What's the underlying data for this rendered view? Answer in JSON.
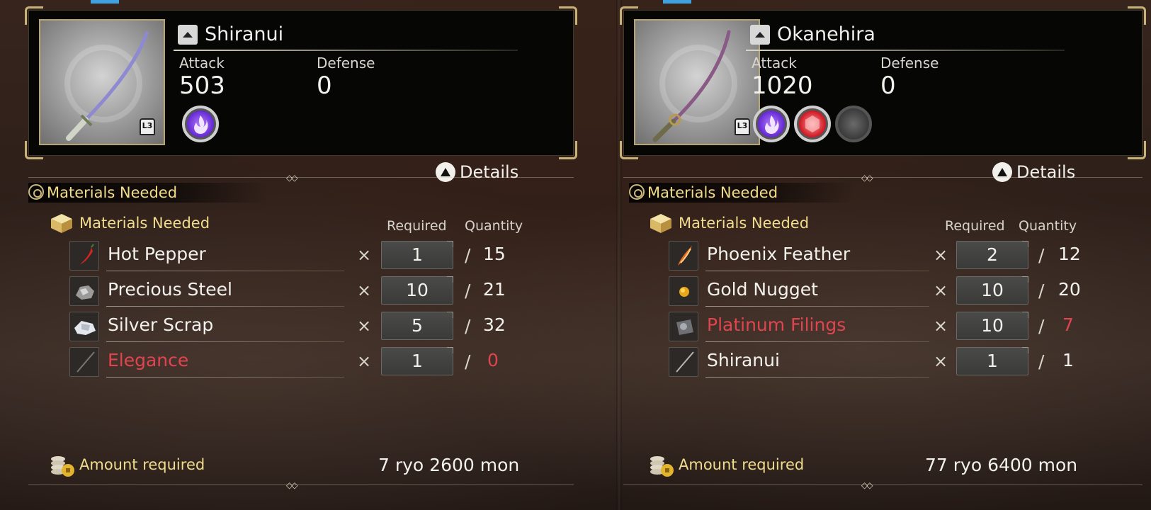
{
  "left": {
    "weapon": {
      "name": "Shiranui",
      "attack_label": "Attack",
      "attack_value": "503",
      "defense_label": "Defense",
      "defense_value": "0",
      "l3_label": "L3",
      "details_label": "Details"
    },
    "section_title": "Materials Needed",
    "materials_subhead": "Materials Needed",
    "col_required": "Required",
    "col_quantity": "Quantity",
    "materials": [
      {
        "name": "Hot Pepper",
        "times": "×",
        "required": "1",
        "slash": "/",
        "quantity": "15",
        "lacking": false,
        "icon": "hot-pepper-icon"
      },
      {
        "name": "Precious Steel",
        "times": "×",
        "required": "10",
        "slash": "/",
        "quantity": "21",
        "lacking": false,
        "icon": "precious-steel-icon"
      },
      {
        "name": "Silver Scrap",
        "times": "×",
        "required": "5",
        "slash": "/",
        "quantity": "32",
        "lacking": false,
        "icon": "silver-scrap-icon"
      },
      {
        "name": "Elegance",
        "times": "×",
        "required": "1",
        "slash": "/",
        "quantity": "0",
        "lacking": true,
        "icon": "sword-icon"
      }
    ],
    "amount_label": "Amount required",
    "amount_value": "7 ryo 2600 mon"
  },
  "right": {
    "weapon": {
      "name": "Okanehira",
      "attack_label": "Attack",
      "attack_value": "1020",
      "defense_label": "Defense",
      "defense_value": "0",
      "l3_label": "L3",
      "details_label": "Details"
    },
    "section_title": "Materials Needed",
    "materials_subhead": "Materials Needed",
    "col_required": "Required",
    "col_quantity": "Quantity",
    "materials": [
      {
        "name": "Phoenix Feather",
        "times": "×",
        "required": "2",
        "slash": "/",
        "quantity": "12",
        "lacking": false,
        "icon": "phoenix-feather-icon"
      },
      {
        "name": "Gold Nugget",
        "times": "×",
        "required": "10",
        "slash": "/",
        "quantity": "20",
        "lacking": false,
        "icon": "gold-nugget-icon"
      },
      {
        "name": "Platinum Filings",
        "times": "×",
        "required": "10",
        "slash": "/",
        "quantity": "7",
        "lacking": true,
        "icon": "platinum-filings-icon"
      },
      {
        "name": "Shiranui",
        "times": "×",
        "required": "1",
        "slash": "/",
        "quantity": "1",
        "lacking": false,
        "icon": "sword-icon"
      }
    ],
    "amount_label": "Amount required",
    "amount_value": "77 ryo 6400 mon"
  },
  "colors": {
    "lacking": "#e0454f",
    "gold_text": "#f0dc8c",
    "frame_gold": "#c7b27a"
  }
}
